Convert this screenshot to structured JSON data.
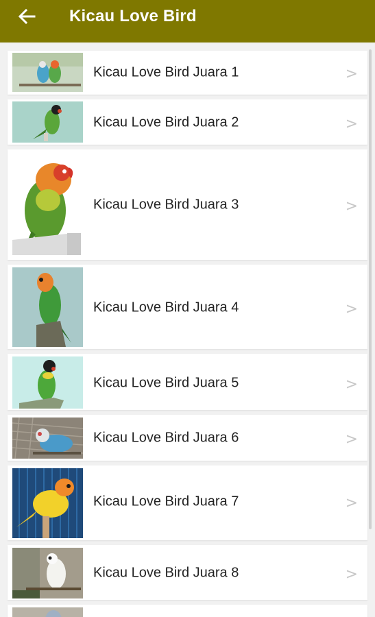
{
  "appbar": {
    "title": "Kicau Love Bird",
    "back_icon": "arrow-left-icon",
    "color": "#7f7800"
  },
  "list": {
    "chevron": ">",
    "items": [
      {
        "label": "Kicau Love Bird Juara 1"
      },
      {
        "label": "Kicau Love Bird Juara 2"
      },
      {
        "label": "Kicau Love Bird Juara 3"
      },
      {
        "label": "Kicau Love Bird Juara 4"
      },
      {
        "label": "Kicau Love Bird Juara 5"
      },
      {
        "label": "Kicau Love Bird Juara 6"
      },
      {
        "label": "Kicau Love Bird Juara 7"
      },
      {
        "label": "Kicau Love Bird Juara 8"
      }
    ]
  }
}
